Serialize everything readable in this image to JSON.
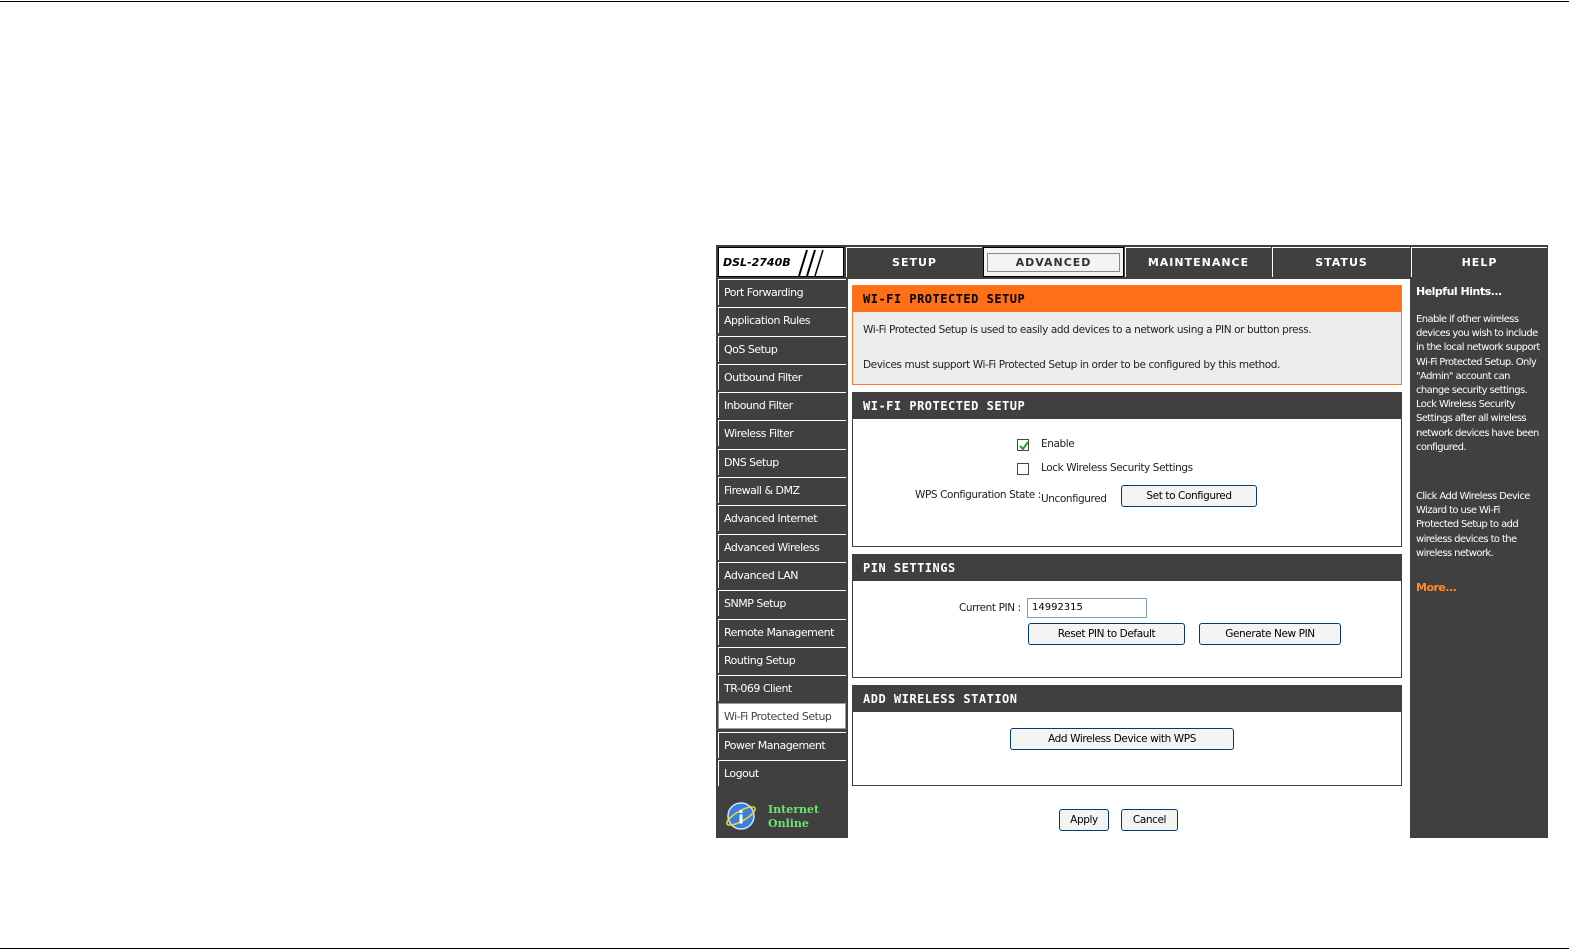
{
  "header": {
    "model": "DSL-2740B",
    "tabs": [
      "SETUP",
      "ADVANCED",
      "MAINTENANCE",
      "STATUS",
      "HELP"
    ],
    "active_tab": "ADVANCED"
  },
  "sidebar": {
    "items": [
      "Port Forwarding",
      "Application Rules",
      "QoS Setup",
      "Outbound Filter",
      "Inbound Filter",
      "Wireless Filter",
      "DNS Setup",
      "Firewall & DMZ",
      "Advanced Internet",
      "Advanced Wireless",
      "Advanced LAN",
      "SNMP Setup",
      "Remote Management",
      "Routing Setup",
      "TR-069 Client",
      "Wi-Fi Protected Setup",
      "Power Management",
      "Logout"
    ],
    "active_item": "Wi-Fi Protected Setup",
    "status": {
      "line1": "Internet",
      "line2": "Online"
    }
  },
  "intro": {
    "title": "WI-FI PROTECTED SETUP",
    "text1": "Wi-Fi Protected Setup is used to easily add devices to a network using a PIN or button press.",
    "text2": "Devices must support Wi-Fi Protected Setup in order to be configured by this method."
  },
  "wps": {
    "title": "WI-FI PROTECTED SETUP",
    "enable_label": "Enable",
    "enable_checked": true,
    "lock_label": "Lock Wireless Security Settings",
    "lock_checked": false,
    "state_label": "WPS Configuration State :",
    "state_value": "Unconfigured",
    "set_configured": "Set to Configured"
  },
  "pin": {
    "title": "PIN SETTINGS",
    "current_label": "Current PIN :",
    "current_value": "14992315",
    "reset_button": "Reset PIN to Default",
    "generate_button": "Generate New PIN"
  },
  "station": {
    "title": "ADD WIRELESS STATION",
    "add_button": "Add Wireless Device with WPS"
  },
  "actions": {
    "apply": "Apply",
    "cancel": "Cancel"
  },
  "help": {
    "title": "Helpful Hints...",
    "text1": "Enable if other wireless devices you wish to include in the local network support Wi-Fi Protected Setup. Only \"Admin\" account can change security settings. Lock Wireless Security Settings after all wireless network devices have been configured.",
    "text2": "Click Add Wireless Device Wizard to use Wi-Fi Protected Setup to add wireless devices to the wireless network.",
    "more": "More..."
  },
  "colors": {
    "accent": "#ff6f16",
    "dark": "#404040",
    "more_link": "#ff8b2c",
    "online_green": "#6de36d"
  }
}
